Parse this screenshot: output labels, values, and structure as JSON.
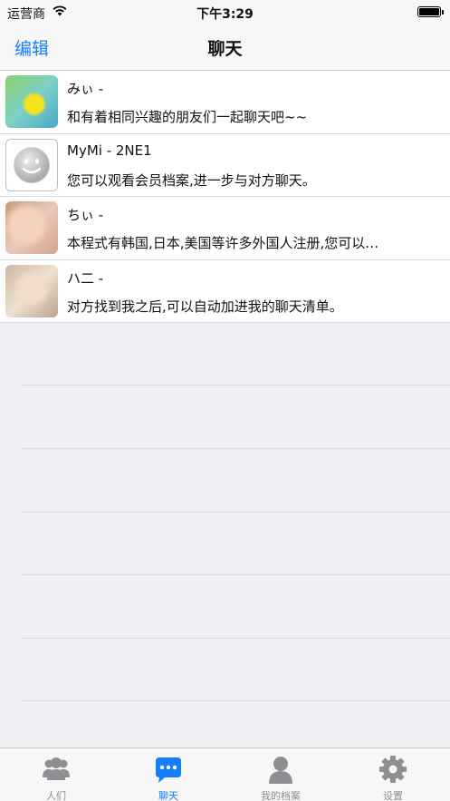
{
  "status": {
    "carrier": "运营商",
    "time": "下午3:29"
  },
  "nav": {
    "edit_label": "编辑",
    "title": "聊天"
  },
  "chats": [
    {
      "name": "みぃ -",
      "preview": "和有着相同兴趣的朋友们一起聊天吧~~"
    },
    {
      "name": "MyMi - 2NE1",
      "preview": "您可以观看会员档案,进一步与对方聊天。"
    },
    {
      "name": "ちぃ -",
      "preview": "本程式有韩国,日本,美国等许多外国人注册,您可以…"
    },
    {
      "name": "ハ二 -",
      "preview": "对方找到我之后,可以自动加进我的聊天清单。"
    }
  ],
  "tabs": [
    {
      "label": "人们",
      "icon": "people-icon",
      "active": false
    },
    {
      "label": "聊天",
      "icon": "chat-bubble-icon",
      "active": true
    },
    {
      "label": "我的档案",
      "icon": "profile-icon",
      "active": false
    },
    {
      "label": "设置",
      "icon": "gear-icon",
      "active": false
    }
  ],
  "colors": {
    "accent": "#147efb",
    "inactive": "#8e8e93",
    "background": "#efeff4"
  }
}
